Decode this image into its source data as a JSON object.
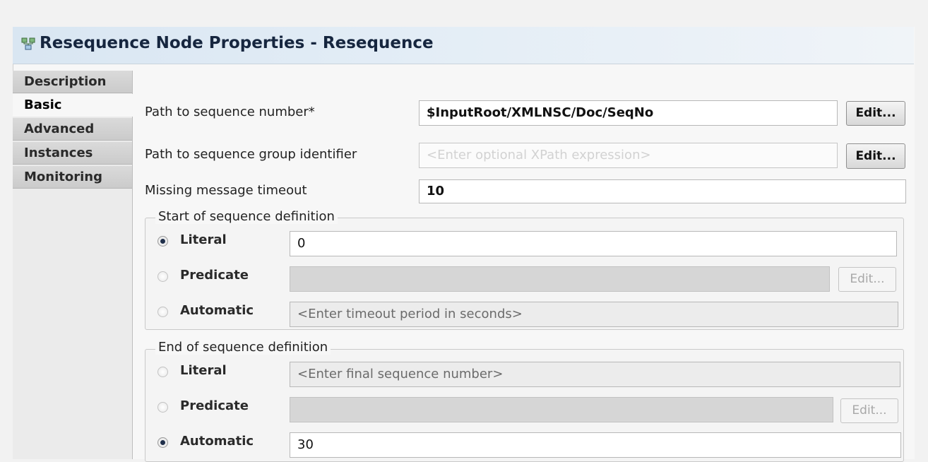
{
  "window": {
    "title": "Resequence Node Properties - Resequence",
    "icon": "node-properties-icon"
  },
  "tabs": [
    {
      "label": "Description",
      "active": false
    },
    {
      "label": "Basic",
      "active": true
    },
    {
      "label": "Advanced",
      "active": false
    },
    {
      "label": "Instances",
      "active": false
    },
    {
      "label": "Monitoring",
      "active": false
    }
  ],
  "basic": {
    "seq_number": {
      "label": "Path to sequence number*",
      "value": "$InputRoot/XMLNSC/Doc/SeqNo",
      "edit_label": "Edit..."
    },
    "seq_group": {
      "label": "Path to sequence group identifier",
      "placeholder": "<Enter optional XPath expression>",
      "edit_label": "Edit..."
    },
    "timeout": {
      "label": "Missing message timeout",
      "value": "10"
    }
  },
  "start_definition": {
    "title": "Start of sequence definition",
    "literal": {
      "label": "Literal",
      "selected": true,
      "value": "0"
    },
    "predicate": {
      "label": "Predicate",
      "selected": false,
      "value": "",
      "edit_label": "Edit..."
    },
    "automatic": {
      "label": "Automatic",
      "selected": false,
      "placeholder": "<Enter timeout period in seconds>"
    }
  },
  "end_definition": {
    "title": "End of sequence definition",
    "literal": {
      "label": "Literal",
      "selected": false,
      "placeholder": "<Enter final sequence number>"
    },
    "predicate": {
      "label": "Predicate",
      "selected": false,
      "value": "",
      "edit_label": "Edit..."
    },
    "automatic": {
      "label": "Automatic",
      "selected": true,
      "value": "30"
    }
  },
  "colors": {
    "title_bar": "#d9e6f2",
    "title_text": "#16263f",
    "disabled_field": "#d6d6d6"
  }
}
